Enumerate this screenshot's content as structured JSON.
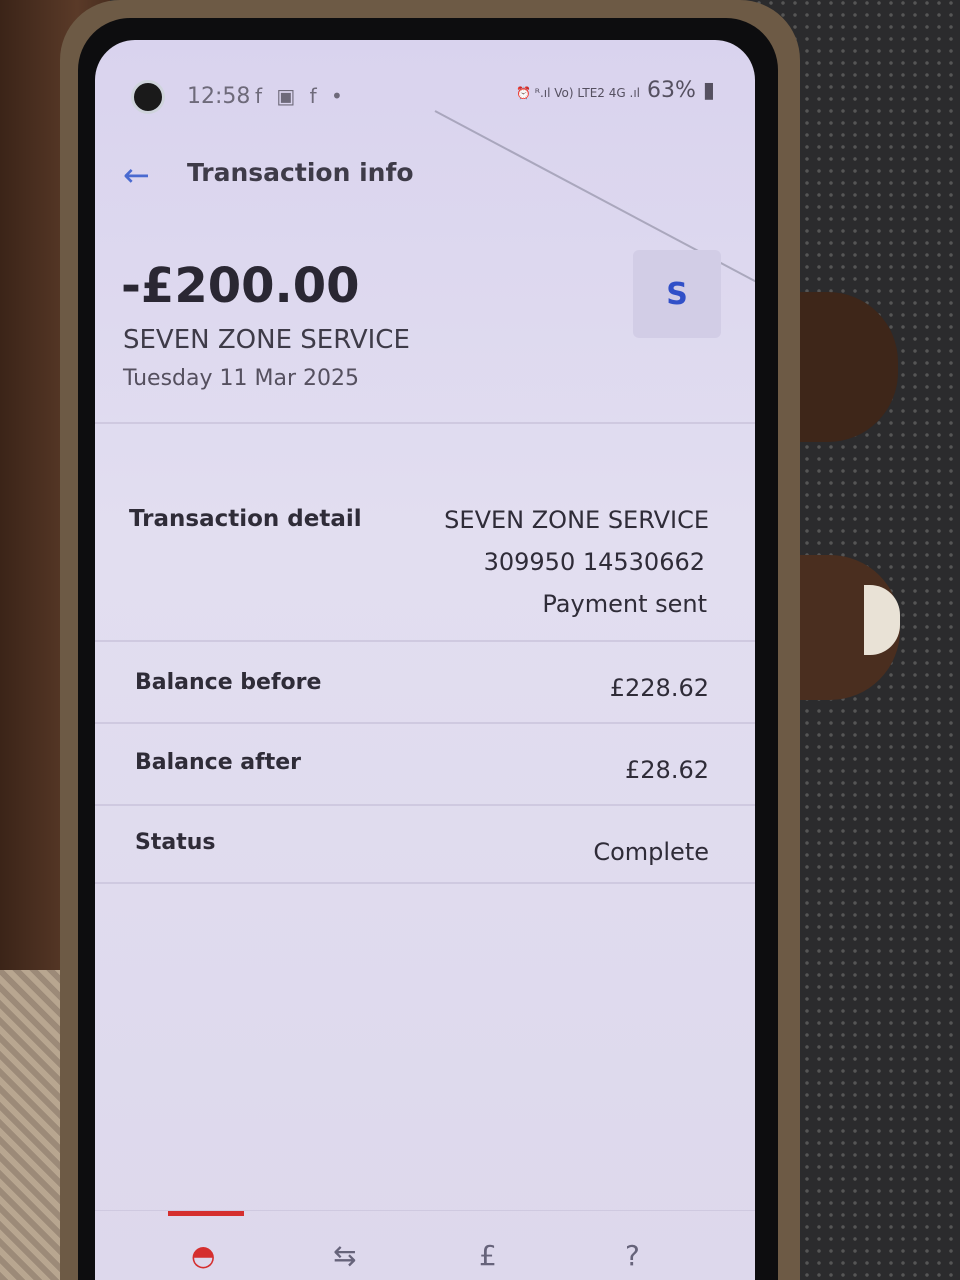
{
  "statusbar": {
    "time": "12:58",
    "notification_icons": "f ▣ f •",
    "signal_text": "⏰ ᴿ.ıl Vo) LTE2 4G .ıl",
    "battery": "63%"
  },
  "header": {
    "title": "Transaction info"
  },
  "transaction": {
    "amount": "-£200.00",
    "merchant": "SEVEN ZONE SERVICE",
    "date": "Tuesday 11 Mar 2025",
    "avatar_letter": "S"
  },
  "details": {
    "detail_label": "Transaction detail",
    "detail_name": "SEVEN ZONE SERVICE",
    "detail_account": "309950 14530662",
    "detail_status": "Payment sent",
    "balance_before_label": "Balance before",
    "balance_before_value": "£228.62",
    "balance_after_label": "Balance after",
    "balance_after_value": "£28.62",
    "status_label": "Status",
    "status_value": "Complete"
  },
  "bottom_nav": {
    "items": [
      {
        "icon": "home-icon",
        "glyph": "◓"
      },
      {
        "icon": "transfer-icon",
        "glyph": "⇆"
      },
      {
        "icon": "pound-icon",
        "glyph": "£"
      },
      {
        "icon": "help-icon",
        "glyph": "?"
      }
    ]
  },
  "colors": {
    "accent": "#4a6ad0",
    "active_tab": "#d52e2e",
    "avatar_text": "#3150c8"
  }
}
